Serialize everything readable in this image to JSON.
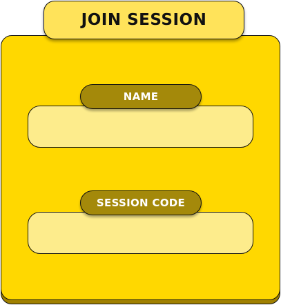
{
  "title": "JOIN SESSION",
  "fields": [
    {
      "label": "NAME",
      "value": "",
      "placeholder": ""
    },
    {
      "label": "SESSION CODE",
      "value": "",
      "placeholder": ""
    }
  ],
  "colors": {
    "panel": "#ffd800",
    "panel_shadow": "#a08000",
    "title_tab": "#ffe35a",
    "field_bg": "#fdec8c",
    "label_pill": "#a4890a",
    "label_text": "#ffffff",
    "border": "#111111"
  }
}
